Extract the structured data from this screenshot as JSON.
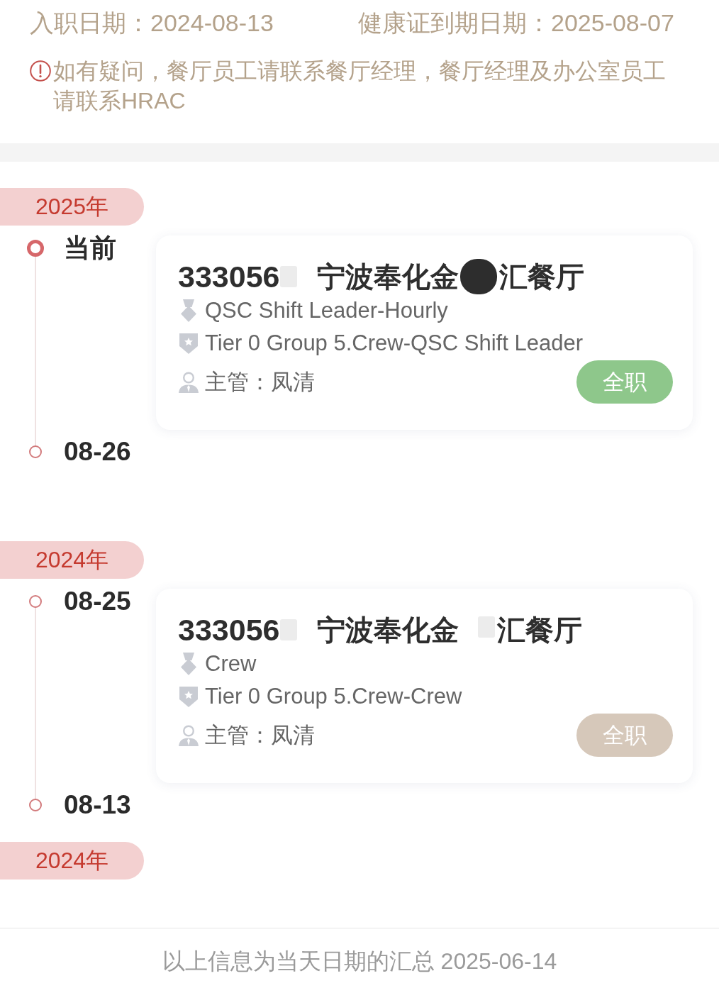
{
  "header": {
    "hire_date": "入职日期：2024-08-13",
    "health_certificate_expiry": "健康证到期日期：2025-08-07",
    "notice": "如有疑问，餐厅员工请联系餐厅经理，餐厅经理及办公室员工请联系HRAC"
  },
  "timeline": [
    {
      "kind": "year",
      "label": "2025年"
    },
    {
      "kind": "period",
      "start": {
        "label": "当前",
        "current": true
      },
      "end": {
        "label": "08-26",
        "current": false
      },
      "card": {
        "title": [
          {
            "kind": "code",
            "text": "333056"
          },
          {
            "kind": "redaction",
            "dark": false
          },
          {
            "kind": "name",
            "text": "宁波奉化金"
          },
          {
            "kind": "redaction",
            "dark": true
          },
          {
            "kind": "name",
            "text": "汇餐厅"
          }
        ],
        "position": "QSC Shift Leader-Hourly",
        "grade": "Tier 0 Group 5.Crew-QSC Shift Leader",
        "supervisor": "主管：凤清",
        "badge": {
          "label": "全职",
          "color": "#8ec78b"
        }
      }
    },
    {
      "kind": "year",
      "label": "2024年"
    },
    {
      "kind": "period",
      "start": {
        "label": "08-25",
        "current": false
      },
      "end": {
        "label": "08-13",
        "current": false
      },
      "card": {
        "title": [
          {
            "kind": "code",
            "text": "333056"
          },
          {
            "kind": "redaction",
            "dark": false
          },
          {
            "kind": "name",
            "text": "宁波奉化金"
          },
          {
            "kind": "redaction",
            "dark": false
          },
          {
            "kind": "name",
            "text": "汇餐厅"
          }
        ],
        "position": "Crew",
        "grade": "Tier 0 Group 5.Crew-Crew",
        "supervisor": "主管：凤清",
        "badge": {
          "label": "全职",
          "color": "#d6c8ba"
        }
      }
    },
    {
      "kind": "year",
      "label": "2024年"
    }
  ],
  "footer": {
    "summary": "以上信息为当天日期的汇总 2025-06-14"
  }
}
